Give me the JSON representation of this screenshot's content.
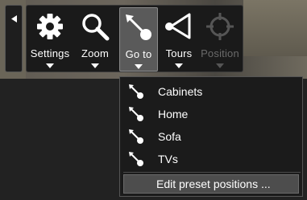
{
  "toolbar": {
    "buttons": [
      {
        "label": "Settings",
        "icon": "gear-icon",
        "enabled": true,
        "active": false
      },
      {
        "label": "Zoom",
        "icon": "magnifier-icon",
        "enabled": true,
        "active": false
      },
      {
        "label": "Go to",
        "icon": "goto-arrow-icon",
        "enabled": true,
        "active": true
      },
      {
        "label": "Tours",
        "icon": "tours-flag-icon",
        "enabled": true,
        "active": false
      },
      {
        "label": "Position",
        "icon": "crosshair-icon",
        "enabled": false,
        "active": false
      }
    ]
  },
  "goto_menu": {
    "items": [
      {
        "label": "Cabinets",
        "icon": "goto-arrow-icon"
      },
      {
        "label": "Home",
        "icon": "goto-arrow-icon"
      },
      {
        "label": "Sofa",
        "icon": "goto-arrow-icon"
      },
      {
        "label": "TVs",
        "icon": "goto-arrow-icon"
      }
    ],
    "edit_label": "Edit preset positions ..."
  },
  "colors": {
    "toolbar_bg": "#1a1a1a",
    "active_bg": "#5a5a5a",
    "disabled_text": "#6a6a6a",
    "menu_bg": "#1b1b1b"
  }
}
